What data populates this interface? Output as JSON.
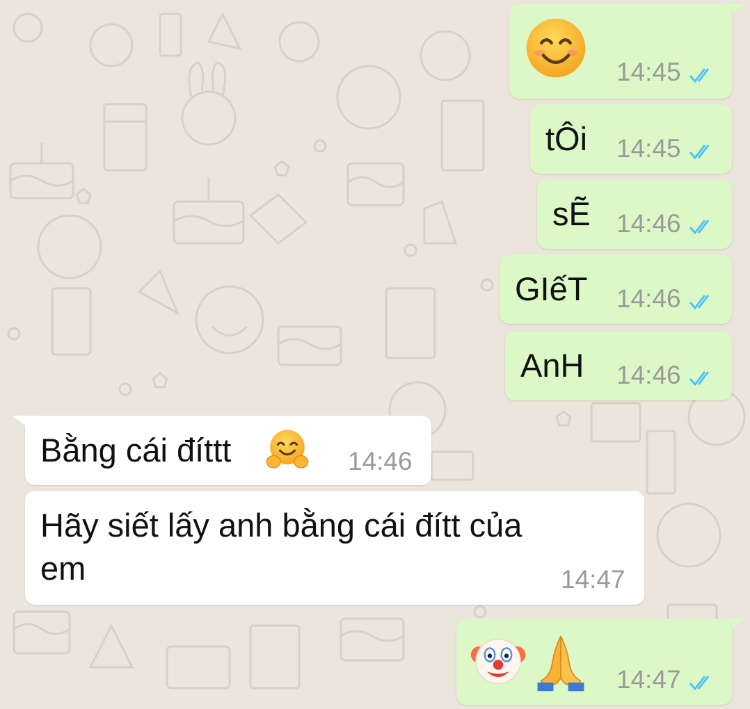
{
  "colors": {
    "chat_background": "#ece5dd",
    "outgoing_bubble": "#dcf8c6",
    "incoming_bubble": "#ffffff",
    "read_ticks": "#4fc3f7",
    "timestamp": "#9a9a9a"
  },
  "messages": [
    {
      "direction": "outgoing",
      "content": "smiling-face-emoji",
      "time": "14:45",
      "status": "read"
    },
    {
      "direction": "outgoing",
      "text": "tÔi",
      "time": "14:45",
      "status": "read"
    },
    {
      "direction": "outgoing",
      "text": "sẼ",
      "time": "14:46",
      "status": "read"
    },
    {
      "direction": "outgoing",
      "text": "GIếT",
      "time": "14:46",
      "status": "read"
    },
    {
      "direction": "outgoing",
      "text": "AnH",
      "time": "14:46",
      "status": "read"
    },
    {
      "direction": "incoming",
      "text": "Bằng cái đíttt",
      "emoji": "hugging-face-emoji",
      "time": "14:46"
    },
    {
      "direction": "incoming",
      "text_line1": "Hãy siết lấy anh bằng cái đítt của",
      "text_line2": "em",
      "time": "14:47"
    },
    {
      "direction": "outgoing",
      "content": [
        "clown-face-emoji",
        "folded-hands-emoji"
      ],
      "time": "14:47",
      "status": "read"
    }
  ]
}
